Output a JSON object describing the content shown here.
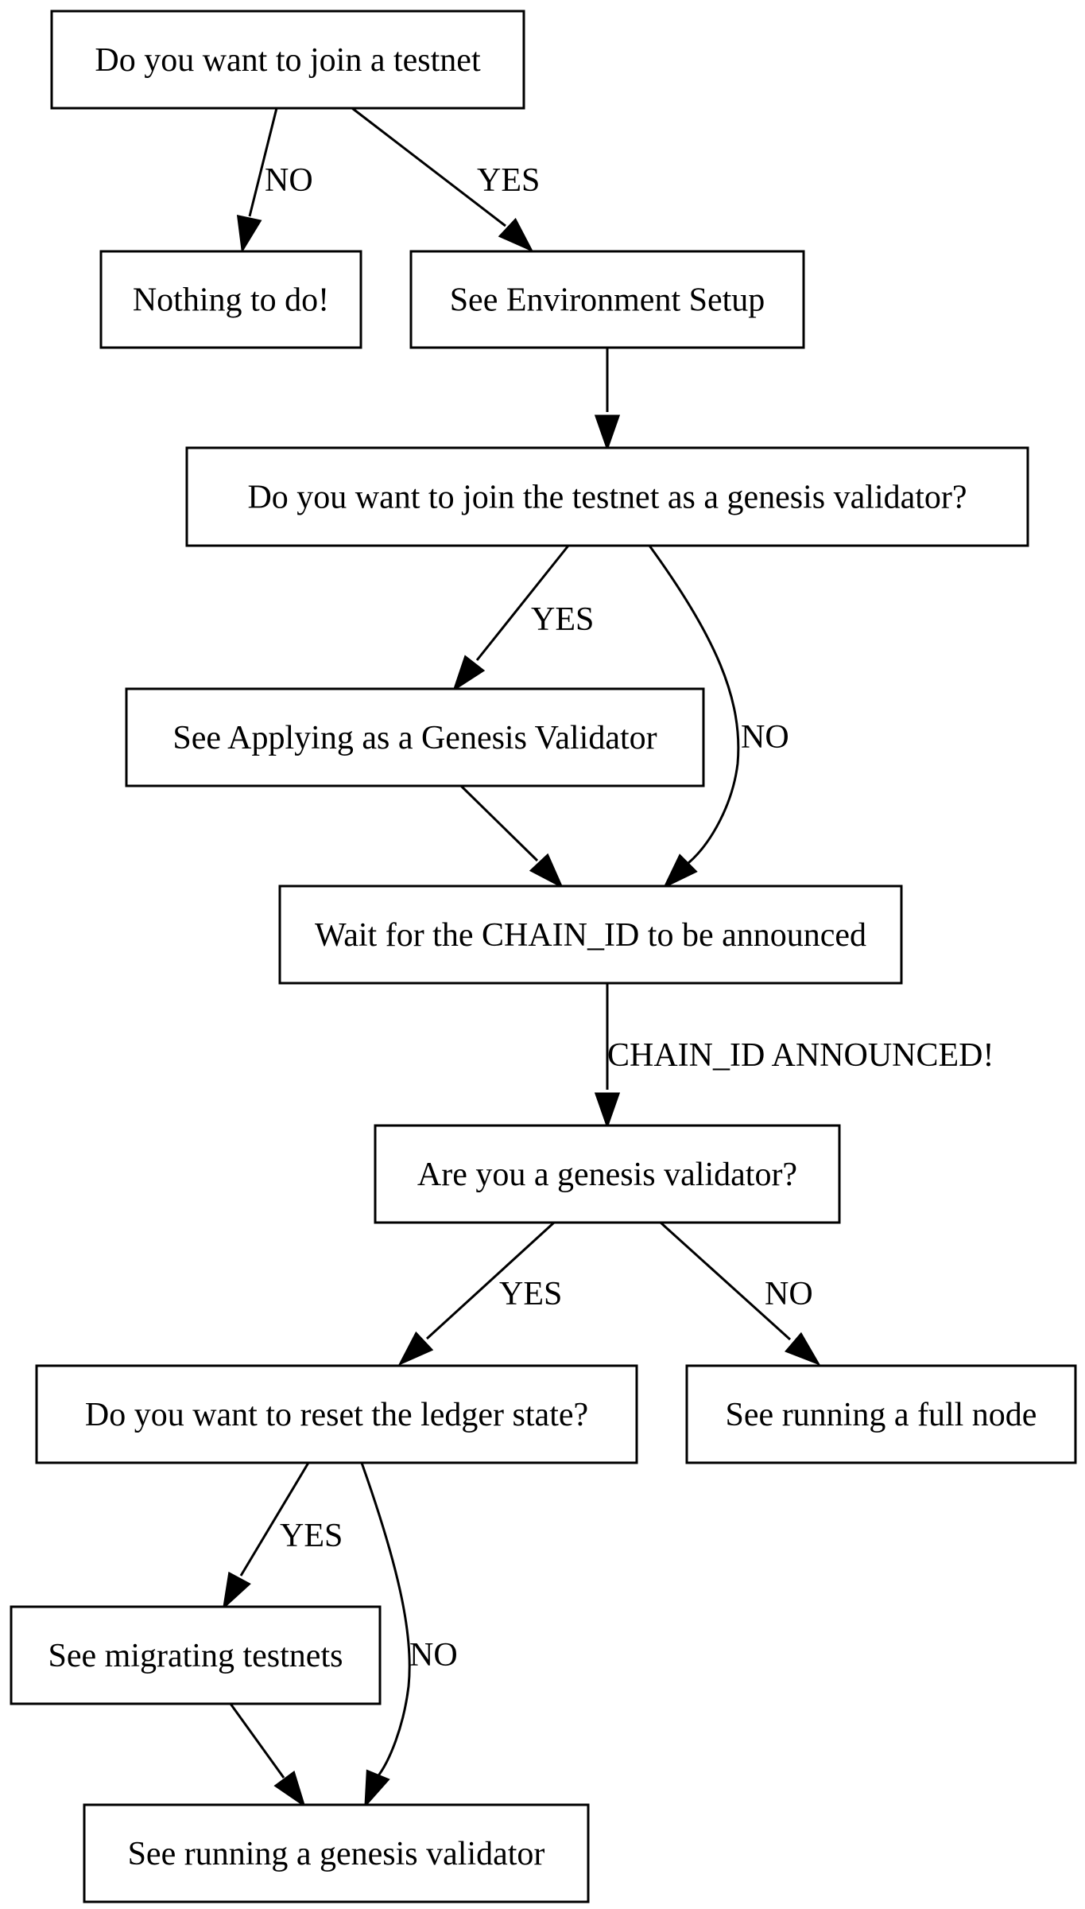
{
  "diagram": {
    "type": "flowchart",
    "nodes": [
      {
        "id": "join_testnet",
        "label": "Do you want to join a testnet"
      },
      {
        "id": "nothing",
        "label": "Nothing to do!"
      },
      {
        "id": "env_setup",
        "label": "See Environment Setup"
      },
      {
        "id": "genesis_q",
        "label": "Do you want to join the testnet as a genesis validator?"
      },
      {
        "id": "apply_genesis",
        "label": "See Applying as a Genesis Validator"
      },
      {
        "id": "wait_chain",
        "label": "Wait for the CHAIN_ID to be announced"
      },
      {
        "id": "are_genesis",
        "label": "Are you a genesis validator?"
      },
      {
        "id": "reset_ledger",
        "label": "Do you want to reset the ledger state?"
      },
      {
        "id": "full_node",
        "label": "See running a full node"
      },
      {
        "id": "migrating",
        "label": "See migrating testnets"
      },
      {
        "id": "run_genesis",
        "label": "See running a genesis validator"
      }
    ],
    "edges": [
      {
        "from": "join_testnet",
        "to": "nothing",
        "label": "NO"
      },
      {
        "from": "join_testnet",
        "to": "env_setup",
        "label": "YES"
      },
      {
        "from": "env_setup",
        "to": "genesis_q",
        "label": ""
      },
      {
        "from": "genesis_q",
        "to": "apply_genesis",
        "label": "YES"
      },
      {
        "from": "genesis_q",
        "to": "wait_chain",
        "label": "NO"
      },
      {
        "from": "apply_genesis",
        "to": "wait_chain",
        "label": ""
      },
      {
        "from": "wait_chain",
        "to": "are_genesis",
        "label": "CHAIN_ID ANNOUNCED!"
      },
      {
        "from": "are_genesis",
        "to": "reset_ledger",
        "label": "YES"
      },
      {
        "from": "are_genesis",
        "to": "full_node",
        "label": "NO"
      },
      {
        "from": "reset_ledger",
        "to": "migrating",
        "label": "YES"
      },
      {
        "from": "reset_ledger",
        "to": "run_genesis",
        "label": "NO"
      },
      {
        "from": "migrating",
        "to": "run_genesis",
        "label": ""
      }
    ]
  }
}
